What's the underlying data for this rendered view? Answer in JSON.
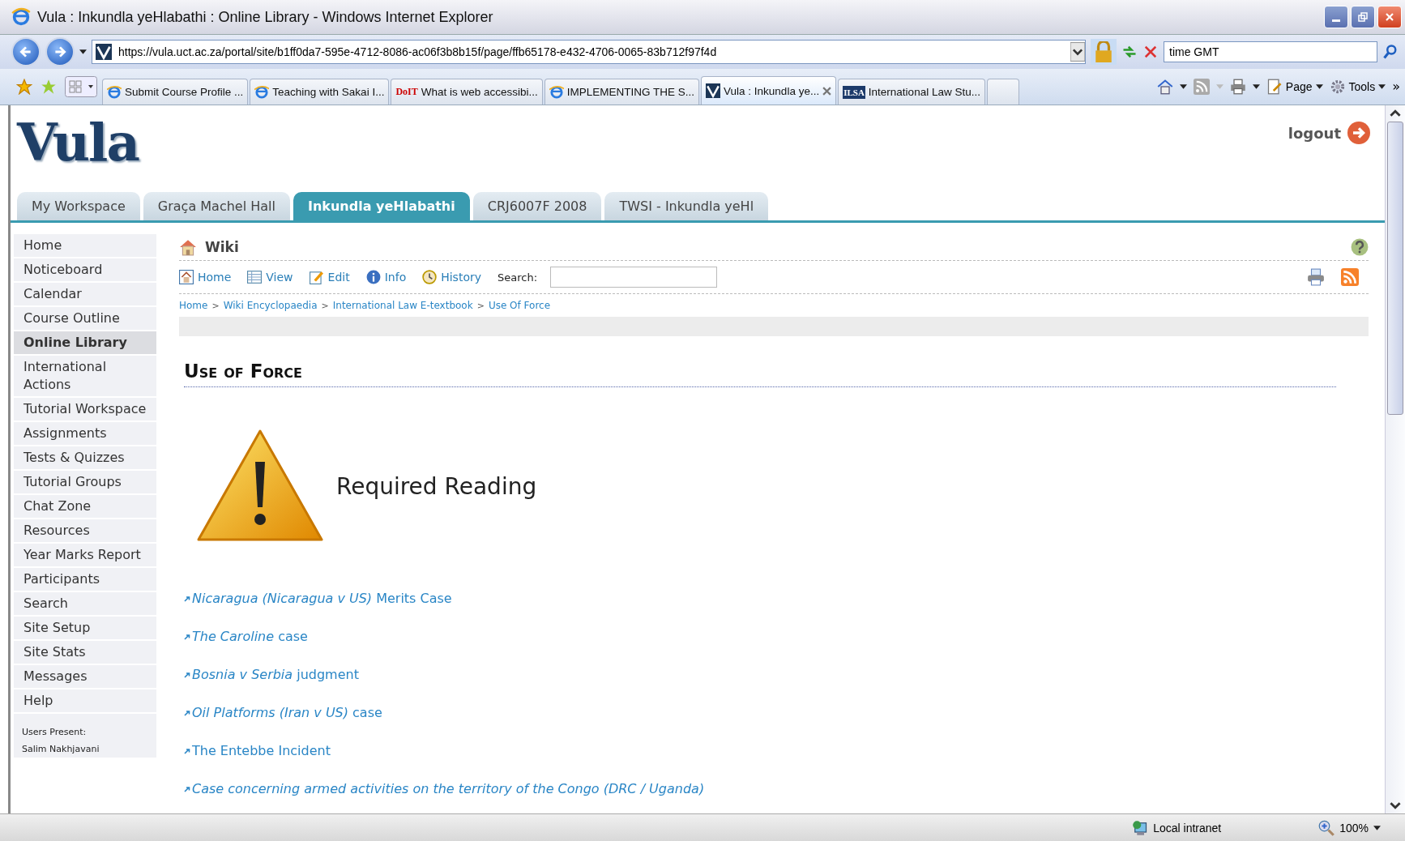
{
  "window": {
    "title": "Vula : Inkundla yeHlabathi : Online Library - Windows Internet Explorer"
  },
  "address_bar": {
    "value": "https://vula.uct.ac.za/portal/site/b1ff0da7-595e-4712-8086-ac06f3b8b15f/page/ffb65178-e432-4706-0065-83b712f97f4d"
  },
  "search_box": {
    "value": "time GMT"
  },
  "browser_tabs": [
    {
      "label": "Submit Course Profile ...",
      "kind": "ie",
      "selected": false
    },
    {
      "label": "Teaching with Sakai I...",
      "kind": "ie",
      "selected": false
    },
    {
      "label": "What is web accessibi...",
      "kind": "doit",
      "logo": "DoIT",
      "selected": false
    },
    {
      "label": "IMPLEMENTING THE S...",
      "kind": "ie",
      "selected": false
    },
    {
      "label": "Vula : Inkundla ye...",
      "kind": "vula",
      "selected": true
    },
    {
      "label": "International Law Stu...",
      "kind": "ilsa",
      "logo": "ILSA",
      "selected": false
    }
  ],
  "command_bar": {
    "page": "Page",
    "tools": "Tools",
    "more": "»"
  },
  "site": {
    "logo": "Vula",
    "logout": "logout"
  },
  "site_tabs": [
    {
      "label": "My Workspace",
      "selected": false
    },
    {
      "label": "Graça Machel Hall",
      "selected": false
    },
    {
      "label": "Inkundla yeHlabathi",
      "selected": true
    },
    {
      "label": "CRJ6007F 2008",
      "selected": false
    },
    {
      "label": "TWSI - Inkundla yeHl",
      "selected": false
    }
  ],
  "sidebar": {
    "items": [
      {
        "label": "Home",
        "selected": false
      },
      {
        "label": "Noticeboard",
        "selected": false
      },
      {
        "label": "Calendar",
        "selected": false
      },
      {
        "label": "Course Outline",
        "selected": false
      },
      {
        "label": "Online Library",
        "selected": true
      },
      {
        "label": "International Actions",
        "selected": false
      },
      {
        "label": "Tutorial Workspace",
        "selected": false
      },
      {
        "label": "Assignments",
        "selected": false
      },
      {
        "label": "Tests & Quizzes",
        "selected": false
      },
      {
        "label": "Tutorial Groups",
        "selected": false
      },
      {
        "label": "Chat Zone",
        "selected": false
      },
      {
        "label": "Resources",
        "selected": false
      },
      {
        "label": "Year Marks Report",
        "selected": false
      },
      {
        "label": "Participants",
        "selected": false
      },
      {
        "label": "Search",
        "selected": false
      },
      {
        "label": "Site Setup",
        "selected": false
      },
      {
        "label": "Site Stats",
        "selected": false
      },
      {
        "label": "Messages",
        "selected": false
      },
      {
        "label": "Help",
        "selected": false
      }
    ],
    "users_present_label": "Users Present:",
    "users": [
      "Salim Nakhjavani"
    ]
  },
  "tool": {
    "title": "Wiki",
    "toolbar": [
      {
        "label": "Home",
        "kind": "home"
      },
      {
        "label": "View",
        "kind": "view"
      },
      {
        "label": "Edit",
        "kind": "edit"
      },
      {
        "label": "Info",
        "kind": "info"
      },
      {
        "label": "History",
        "kind": "history"
      }
    ],
    "search_label": "Search:",
    "breadcrumbs": [
      "Home",
      "Wiki Encyclopaedia",
      "International Law E-textbook",
      "Use Of Force"
    ],
    "breadcrumb_separator": ">"
  },
  "article": {
    "heading": "Use of Force",
    "callout": "Required Reading",
    "links": [
      "*Nicaragua (Nicaragua v US)* Merits Case",
      " *The Caroline* case",
      " *Bosnia v Serbia* judgment",
      "*Oil Platforms (Iran v US)* case",
      "The Entebbe Incident",
      "*Case concerning armed activities on the territory of the Congo (DRC / Uganda)*"
    ]
  },
  "status_bar": {
    "zone": "Local intranet",
    "zoom": "100%"
  }
}
